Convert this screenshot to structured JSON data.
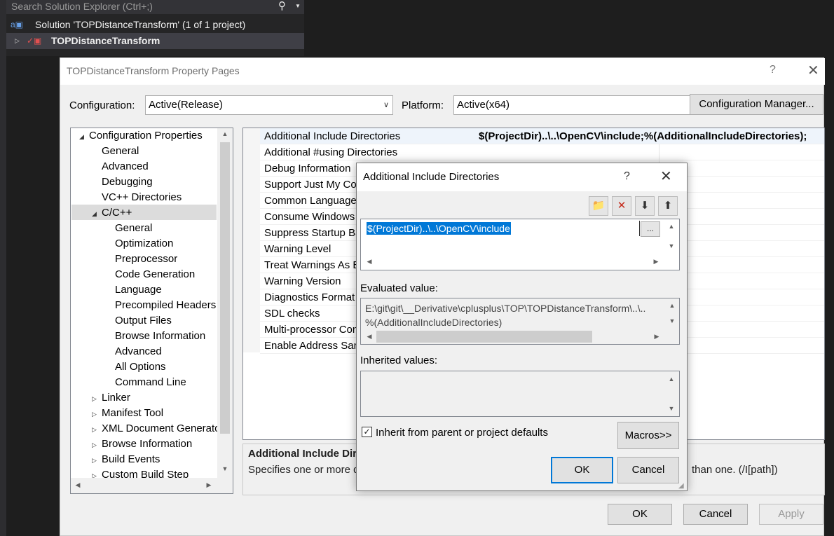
{
  "solution_explorer": {
    "search_placeholder": "Search Solution Explorer (Ctrl+;)",
    "solution_label": "Solution 'TOPDistanceTransform' (1 of 1 project)",
    "project_label": "TOPDistanceTransform"
  },
  "property_pages": {
    "title": "TOPDistanceTransform Property Pages",
    "help": "?",
    "close": "✕",
    "configuration_label": "Configuration:",
    "configuration_value": "Active(Release)",
    "platform_label": "Platform:",
    "platform_value": "Active(x64)",
    "config_manager_label": "Configuration Manager...",
    "tree": [
      {
        "label": "Configuration Properties",
        "level": 0,
        "expander": "◢"
      },
      {
        "label": "General",
        "level": 1,
        "expander": ""
      },
      {
        "label": "Advanced",
        "level": 1,
        "expander": ""
      },
      {
        "label": "Debugging",
        "level": 1,
        "expander": ""
      },
      {
        "label": "VC++ Directories",
        "level": 1,
        "expander": ""
      },
      {
        "label": "C/C++",
        "level": 1,
        "expander": "◢"
      },
      {
        "label": "General",
        "level": 2,
        "expander": ""
      },
      {
        "label": "Optimization",
        "level": 2,
        "expander": ""
      },
      {
        "label": "Preprocessor",
        "level": 2,
        "expander": ""
      },
      {
        "label": "Code Generation",
        "level": 2,
        "expander": ""
      },
      {
        "label": "Language",
        "level": 2,
        "expander": ""
      },
      {
        "label": "Precompiled Headers",
        "level": 2,
        "expander": ""
      },
      {
        "label": "Output Files",
        "level": 2,
        "expander": ""
      },
      {
        "label": "Browse Information",
        "level": 2,
        "expander": ""
      },
      {
        "label": "Advanced",
        "level": 2,
        "expander": ""
      },
      {
        "label": "All Options",
        "level": 2,
        "expander": ""
      },
      {
        "label": "Command Line",
        "level": 2,
        "expander": ""
      },
      {
        "label": "Linker",
        "level": 1,
        "expander": "▷"
      },
      {
        "label": "Manifest Tool",
        "level": 1,
        "expander": "▷"
      },
      {
        "label": "XML Document Generato",
        "level": 1,
        "expander": "▷"
      },
      {
        "label": "Browse Information",
        "level": 1,
        "expander": "▷"
      },
      {
        "label": "Build Events",
        "level": 1,
        "expander": "▷"
      },
      {
        "label": "Custom Build Step",
        "level": 1,
        "expander": "▷"
      }
    ],
    "grid": [
      {
        "name": "Additional Include Directories",
        "value": "$(ProjectDir)..\\..\\OpenCV\\include;%(AdditionalIncludeDirectories);"
      },
      {
        "name": "Additional #using Directories",
        "value": ""
      },
      {
        "name": "Debug Information",
        "value": ""
      },
      {
        "name": "Support Just My Coc",
        "value": ""
      },
      {
        "name": "Common Language",
        "value": ""
      },
      {
        "name": "Consume Windows I",
        "value": ""
      },
      {
        "name": "Suppress Startup Ba",
        "value": ""
      },
      {
        "name": "Warning Level",
        "value": ""
      },
      {
        "name": "Treat Warnings As Er",
        "value": ""
      },
      {
        "name": "Warning Version",
        "value": ""
      },
      {
        "name": "Diagnostics Format",
        "value": ""
      },
      {
        "name": "SDL checks",
        "value": ""
      },
      {
        "name": "Multi-processor Con",
        "value": ""
      },
      {
        "name": "Enable Address Sani",
        "value": ""
      }
    ],
    "description_title": "Additional Include Dire",
    "description_text": "Specifies one or more d",
    "description_tail": "than one.    (/I[path])",
    "ok_label": "OK",
    "cancel_label": "Cancel",
    "apply_label": "Apply"
  },
  "dialog": {
    "title": "Additional Include Directories",
    "help": "?",
    "close": "✕",
    "toolbar": {
      "new_line": "📁",
      "delete": "✕",
      "move_down": "⬇",
      "move_up": "⬆"
    },
    "edit_value": "$(ProjectDir)..\\..\\OpenCV\\include",
    "ellipsis": "...",
    "evaluated_label": "Evaluated value:",
    "evaluated_line1": "E:\\git\\git\\__Derivative\\cplusplus\\TOP\\TOPDistanceTransform\\..\\..",
    "evaluated_line2": "%(AdditionalIncludeDirectories)",
    "inherited_label": "Inherited values:",
    "inherit_checkbox_label": "Inherit from parent or project defaults",
    "inherit_checked": true,
    "macros_label": "Macros>>",
    "ok_label": "OK",
    "cancel_label": "Cancel"
  }
}
